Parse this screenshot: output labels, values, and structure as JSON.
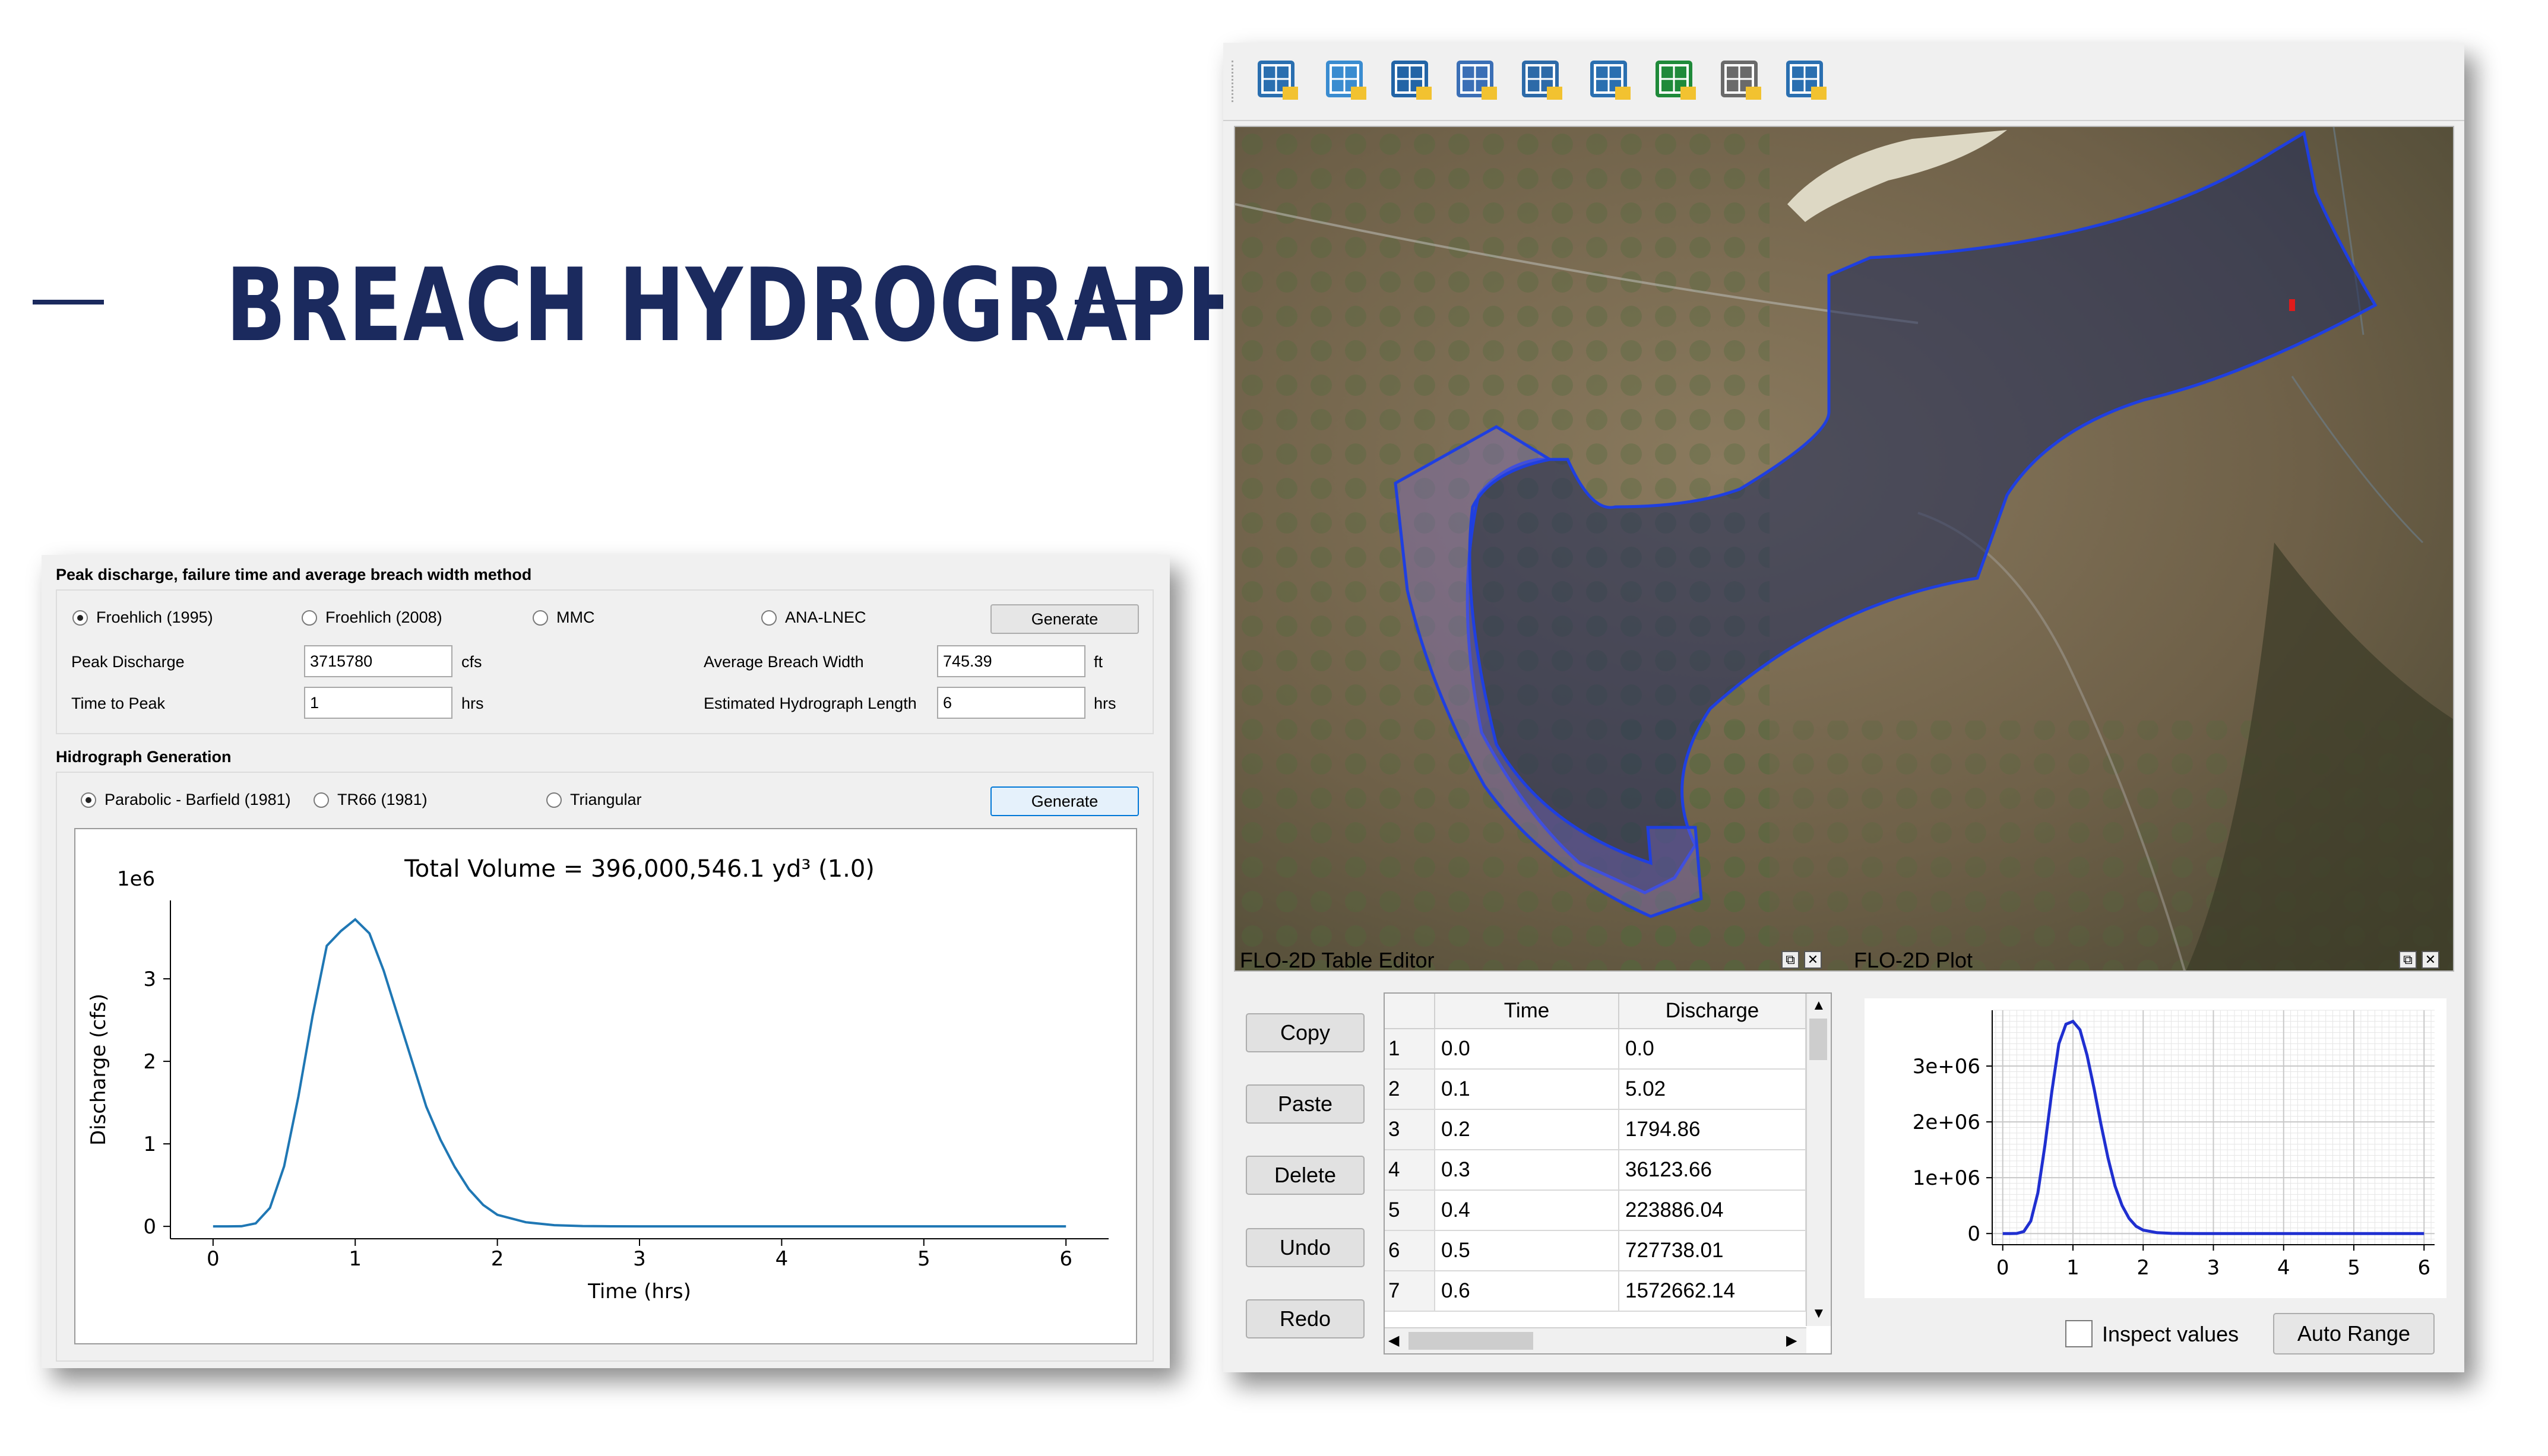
{
  "banner": {
    "title": "BREACH HYDROGRAPH TOOL"
  },
  "dialog": {
    "section1_title": "Peak discharge, failure time and average breach width method",
    "methods": [
      {
        "label": "Froehlich (1995)",
        "selected": true
      },
      {
        "label": "Froehlich (2008)",
        "selected": false
      },
      {
        "label": "MMC",
        "selected": false
      },
      {
        "label": "ANA-LNEC",
        "selected": false
      }
    ],
    "generate_label": "Generate",
    "peak_discharge": {
      "label": "Peak Discharge",
      "value": "3715780",
      "unit": "cfs"
    },
    "time_to_peak": {
      "label": "Time to Peak",
      "value": "1",
      "unit": "hrs"
    },
    "avg_breach_width": {
      "label": "Average Breach Width",
      "value": "745.39",
      "unit": "ft"
    },
    "est_hydro_length": {
      "label": "Estimated Hydrograph Length",
      "value": "6",
      "unit": "hrs"
    },
    "section2_title": "Hidrograph Generation",
    "hydro_methods": [
      {
        "label": "Parabolic - Barfield (1981)",
        "selected": true
      },
      {
        "label": "TR66 (1981)",
        "selected": false
      },
      {
        "label": "Triangular",
        "selected": false
      }
    ],
    "generate2_label": "Generate"
  },
  "chart_data": [
    {
      "type": "line",
      "title": "Total Volume = 396,000,546.1 yd³ (1.0)",
      "xlabel": "Time (hrs)",
      "ylabel": "Discharge (cfs)",
      "y_scale_label": "1e6",
      "xlim": [
        -0.3,
        6.3
      ],
      "ylim": [
        -0.15,
        3.95
      ],
      "xticks": [
        "0",
        "1",
        "2",
        "3",
        "4",
        "5",
        "6"
      ],
      "yticks": [
        "0",
        "1",
        "2",
        "3"
      ],
      "series_color": "#1f77b4",
      "x": [
        0,
        0.1,
        0.2,
        0.3,
        0.4,
        0.5,
        0.6,
        0.7,
        0.8,
        0.9,
        1.0,
        1.1,
        1.2,
        1.3,
        1.4,
        1.5,
        1.6,
        1.7,
        1.8,
        1.9,
        2.0,
        2.2,
        2.4,
        2.6,
        2.8,
        3.0,
        6.0
      ],
      "y": [
        0,
        5e-06,
        0.0018,
        0.036,
        0.224,
        0.728,
        1.573,
        2.55,
        3.4,
        3.58,
        3.72,
        3.55,
        3.1,
        2.55,
        2.0,
        1.45,
        1.05,
        0.72,
        0.45,
        0.26,
        0.14,
        0.05,
        0.015,
        0.004,
        0.001,
        0,
        0
      ],
      "grid": false
    },
    {
      "type": "line",
      "title": "",
      "xticks": [
        "0",
        "1",
        "2",
        "3",
        "4",
        "5",
        "6"
      ],
      "yticks": [
        "0",
        "1e+06",
        "2e+06",
        "3e+06"
      ],
      "xlim": [
        -0.15,
        6.15
      ],
      "ylim": [
        -200000,
        4000000
      ],
      "series_color": "#1f2fd0",
      "grid": true,
      "x": [
        0,
        0.1,
        0.2,
        0.3,
        0.4,
        0.5,
        0.6,
        0.7,
        0.8,
        0.9,
        1.0,
        1.1,
        1.2,
        1.3,
        1.4,
        1.5,
        1.6,
        1.7,
        1.8,
        1.9,
        2.0,
        2.2,
        2.4,
        2.6,
        2.8,
        3.0,
        6.0
      ],
      "y": [
        0,
        5,
        1795,
        36124,
        223886,
        727738,
        1572662,
        2550000,
        3400000,
        3750000,
        3800000,
        3650000,
        3200000,
        2600000,
        1950000,
        1350000,
        850000,
        500000,
        270000,
        130000,
        60000,
        15000,
        3000,
        500,
        0,
        0,
        0
      ]
    }
  ],
  "toolbar": {
    "icons": [
      "flo2d-grid-icon",
      "flo2d-connect-icon",
      "flo2d-globe-icon",
      "grid-table-icon",
      "flo2d-info-globe-icon",
      "flo2d-info-icon",
      "profile-flag-icon",
      "report-icon",
      "flo2d-help-icon"
    ]
  },
  "table_editor": {
    "title": "FLO-2D Table Editor",
    "buttons": [
      "Copy",
      "Paste",
      "Delete",
      "Undo",
      "Redo"
    ],
    "columns": [
      "Time",
      "Discharge"
    ],
    "rows": [
      [
        "1",
        "0.0",
        "0.0"
      ],
      [
        "2",
        "0.1",
        "5.02"
      ],
      [
        "3",
        "0.2",
        "1794.86"
      ],
      [
        "4",
        "0.3",
        "36123.66"
      ],
      [
        "5",
        "0.4",
        "223886.04"
      ],
      [
        "6",
        "0.5",
        "727738.01"
      ],
      [
        "7",
        "0.6",
        "1572662.14"
      ]
    ]
  },
  "plot_panel": {
    "title": "FLO-2D Plot",
    "inspect_label": "Inspect values",
    "auto_range_label": "Auto Range"
  }
}
